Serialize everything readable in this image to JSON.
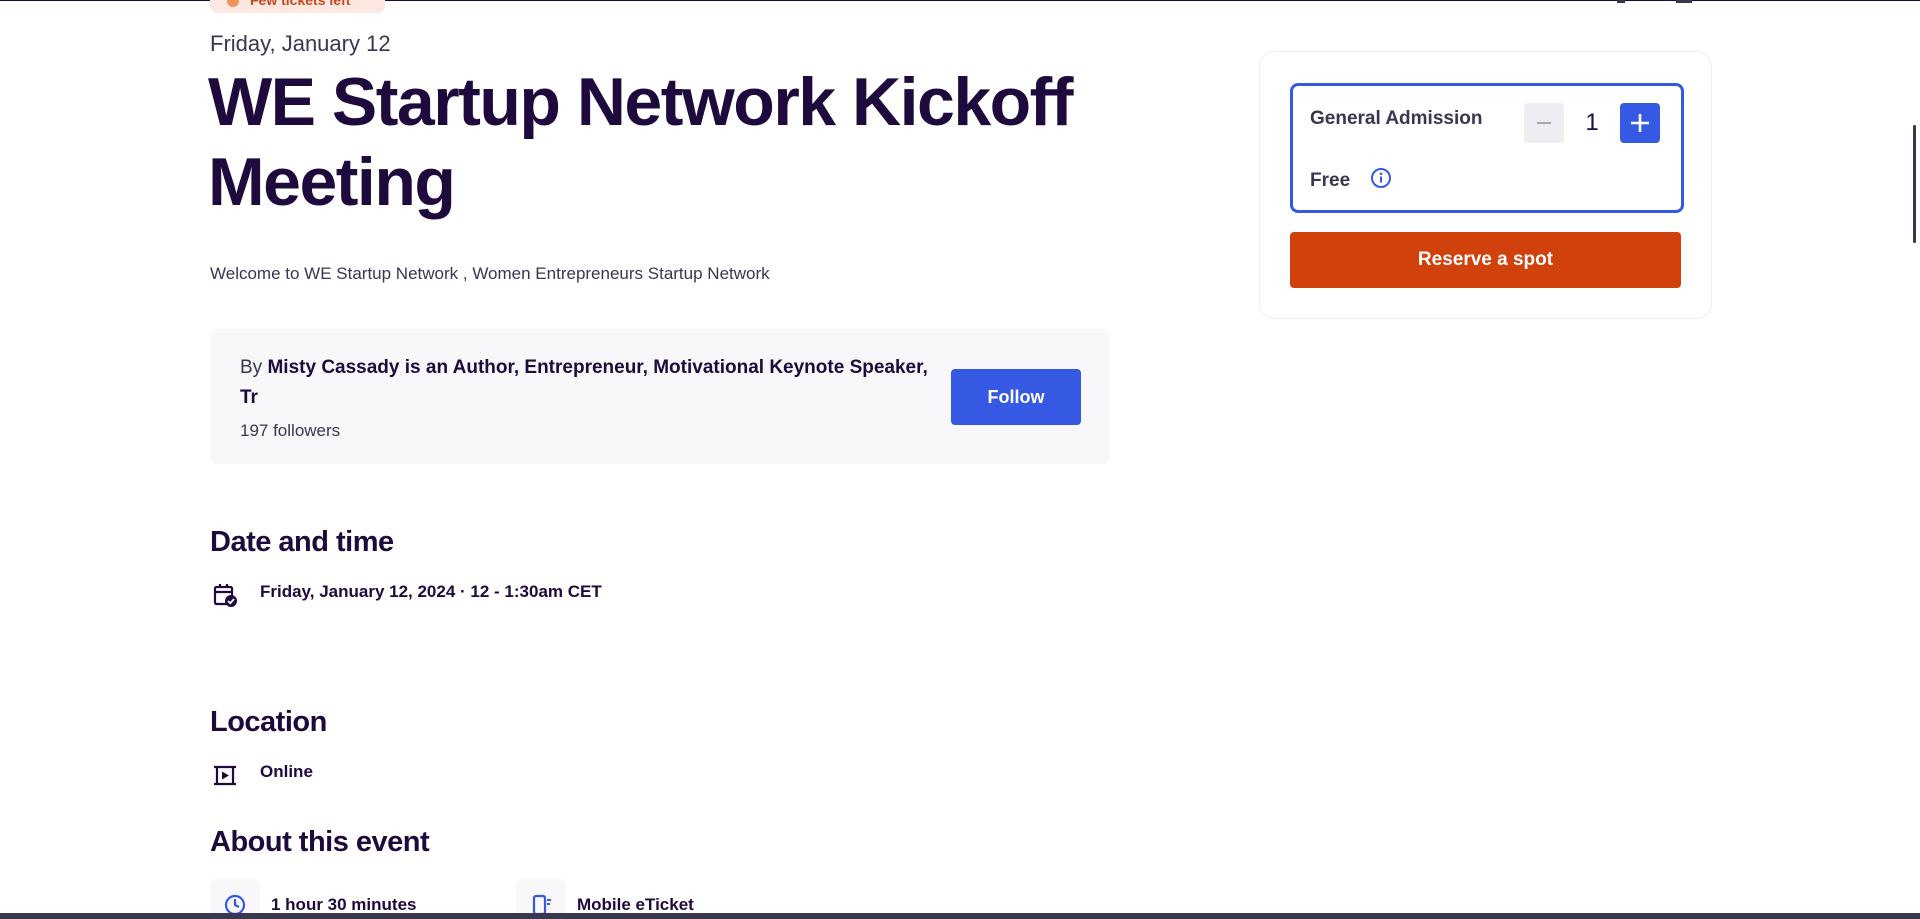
{
  "top_badge": {
    "label": "Few tickets left"
  },
  "event": {
    "date_short": "Friday, January 12",
    "title": "WE Startup Network Kickoff Meeting",
    "summary": "Welcome to WE Startup Network , Women Entrepreneurs Startup Network"
  },
  "organizer": {
    "by_prefix": "By",
    "name": "Misty Cassady is an Author, Entrepreneur, Motivational Keynote Speaker, Tr",
    "followers": "197 followers",
    "follow_label": "Follow"
  },
  "date_and_time": {
    "heading": "Date and time",
    "icon": "calendar-check-icon",
    "value": "Friday, January 12, 2024 · 12 - 1:30am CET"
  },
  "location": {
    "heading": "Location",
    "icon": "online-video-icon",
    "value": "Online"
  },
  "about": {
    "heading": "About this event",
    "highlights": [
      {
        "icon": "clock-icon",
        "label": "1 hour 30 minutes"
      },
      {
        "icon": "mobile-ticket-icon",
        "label": "Mobile eTicket"
      }
    ]
  },
  "ticket_card": {
    "ticket_name": "General Admission",
    "price": "Free",
    "quantity": "1",
    "reserve_label": "Reserve a spot"
  },
  "colors": {
    "primary_text": "#1e0a3c",
    "accent_blue": "#3659e3",
    "cta_orange": "#d1410c",
    "panel_bg": "#f8f7fa"
  }
}
